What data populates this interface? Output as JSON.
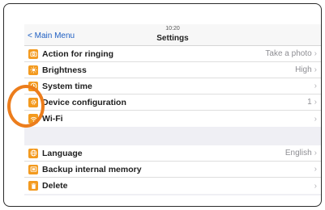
{
  "header": {
    "back_label": "< Main Menu",
    "time": "10:20",
    "title": "Settings"
  },
  "group1": [
    {
      "label": "Action for ringing",
      "value": "Take a photo",
      "icon": "camera-icon"
    },
    {
      "label": "Brightness",
      "value": "High",
      "icon": "brightness-icon"
    },
    {
      "label": "System time",
      "value": "",
      "icon": "clock-icon"
    },
    {
      "label": "Device configuration",
      "value": "1",
      "icon": "gear-icon"
    },
    {
      "label": "Wi-Fi",
      "value": "",
      "icon": "wifi-icon"
    }
  ],
  "group2": [
    {
      "label": "Language",
      "value": "English",
      "icon": "globe-icon"
    },
    {
      "label": "Backup internal memory",
      "value": "",
      "icon": "backup-icon"
    },
    {
      "label": "Delete",
      "value": "",
      "icon": "trash-icon"
    }
  ],
  "colors": {
    "accent": "#f39a1f",
    "highlight_circle": "#ec7d1c",
    "link": "#1f5fc2"
  }
}
